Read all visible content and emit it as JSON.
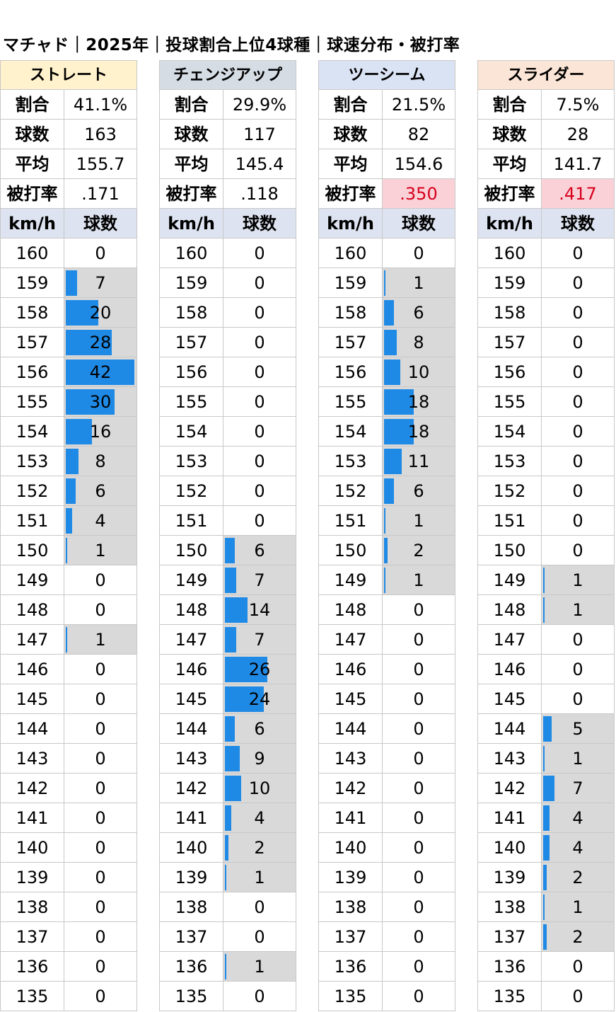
{
  "title": "マチャド｜2025年｜投球割合上位4球種｜球速分布・被打率",
  "chart_data": {
    "type": "table",
    "title": "マチャド｜2025年｜投球割合上位4球種｜球速分布・被打率",
    "speeds": [
      "160",
      "159",
      "158",
      "157",
      "156",
      "155",
      "154",
      "153",
      "152",
      "151",
      "150",
      "149",
      "148",
      "147",
      "146",
      "145",
      "144",
      "143",
      "142",
      "141",
      "140",
      "139",
      "138",
      "137",
      "136",
      "135"
    ],
    "bar_max": 42,
    "labels": {
      "ratio": "割合",
      "count": "球数",
      "avg": "平均",
      "baa": "被打率",
      "kmh": "km/h",
      "pitches": "球数"
    },
    "series": [
      {
        "name": "ストレート",
        "header_color": "#fff2cc",
        "ratio": "41.1%",
        "count": "163",
        "avg": "155.7",
        "baa": ".171",
        "baa_highlight": false,
        "counts": [
          0,
          7,
          20,
          28,
          42,
          30,
          16,
          8,
          6,
          4,
          1,
          0,
          0,
          1,
          0,
          0,
          0,
          0,
          0,
          0,
          0,
          0,
          0,
          0,
          0,
          0
        ]
      },
      {
        "name": "チェンジアップ",
        "header_color": "#d6dce4",
        "ratio": "29.9%",
        "count": "117",
        "avg": "145.4",
        "baa": ".118",
        "baa_highlight": false,
        "counts": [
          0,
          0,
          0,
          0,
          0,
          0,
          0,
          0,
          0,
          0,
          6,
          7,
          14,
          7,
          26,
          24,
          6,
          9,
          10,
          4,
          2,
          1,
          0,
          0,
          1,
          0
        ]
      },
      {
        "name": "ツーシーム",
        "header_color": "#dae3f3",
        "ratio": "21.5%",
        "count": "82",
        "avg": "154.6",
        "baa": ".350",
        "baa_highlight": true,
        "counts": [
          0,
          1,
          6,
          8,
          10,
          18,
          18,
          11,
          6,
          1,
          2,
          1,
          0,
          0,
          0,
          0,
          0,
          0,
          0,
          0,
          0,
          0,
          0,
          0,
          0,
          0
        ]
      },
      {
        "name": "スライダー",
        "header_color": "#fbe5d6",
        "ratio": "7.5%",
        "count": "28",
        "avg": "141.7",
        "baa": ".417",
        "baa_highlight": true,
        "counts": [
          0,
          0,
          0,
          0,
          0,
          0,
          0,
          0,
          0,
          0,
          0,
          1,
          1,
          0,
          0,
          0,
          5,
          1,
          7,
          4,
          4,
          2,
          1,
          2,
          0,
          0
        ]
      }
    ]
  }
}
